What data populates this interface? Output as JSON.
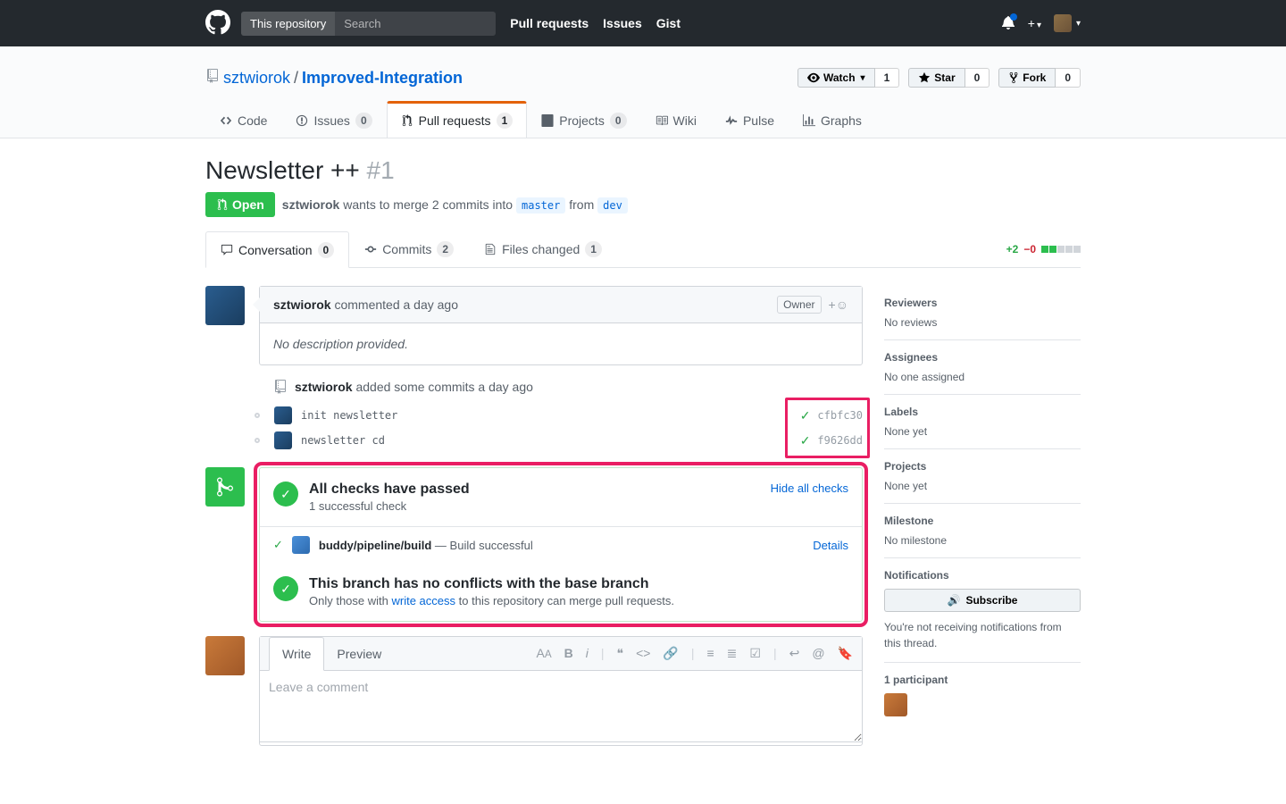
{
  "header": {
    "search_scope": "This repository",
    "search_placeholder": "Search",
    "nav": {
      "pulls": "Pull requests",
      "issues": "Issues",
      "gist": "Gist"
    }
  },
  "repo": {
    "owner": "sztwiorok",
    "name": "Improved-Integration",
    "actions": {
      "watch": {
        "label": "Watch",
        "count": "1"
      },
      "star": {
        "label": "Star",
        "count": "0"
      },
      "fork": {
        "label": "Fork",
        "count": "0"
      }
    },
    "nav": {
      "code": "Code",
      "issues": {
        "label": "Issues",
        "count": "0"
      },
      "pulls": {
        "label": "Pull requests",
        "count": "1"
      },
      "projects": {
        "label": "Projects",
        "count": "0"
      },
      "wiki": "Wiki",
      "pulse": "Pulse",
      "graphs": "Graphs"
    }
  },
  "pr": {
    "title": "Newsletter ++",
    "number": "#1",
    "state": "Open",
    "meta": {
      "author": "sztwiorok",
      "action": "wants to merge 2 commits into",
      "base": "master",
      "from_word": "from",
      "head": "dev"
    },
    "tabs": {
      "conversation": {
        "label": "Conversation",
        "count": "0"
      },
      "commits": {
        "label": "Commits",
        "count": "2"
      },
      "files": {
        "label": "Files changed",
        "count": "1"
      }
    },
    "diff": {
      "additions": "+2",
      "deletions": "−0"
    }
  },
  "comment": {
    "author": "sztwiorok",
    "timestamp": "commented a day ago",
    "owner_badge": "Owner",
    "body": "No description provided."
  },
  "commits_group": {
    "author": "sztwiorok",
    "action": "added some commits a day ago",
    "items": [
      {
        "msg": "init newsletter",
        "sha": "cfbfc30"
      },
      {
        "msg": "newsletter cd",
        "sha": "f9626dd"
      }
    ]
  },
  "merge": {
    "checks_title": "All checks have passed",
    "checks_sub": "1 successful check",
    "hide": "Hide all checks",
    "check": {
      "name": "buddy/pipeline/build",
      "dash": "—",
      "status": "Build successful",
      "details": "Details"
    },
    "conflict_title": "This branch has no conflicts with the base branch",
    "conflict_sub_pre": "Only those with ",
    "conflict_link": "write access",
    "conflict_sub_post": " to this repository can merge pull requests."
  },
  "form": {
    "write": "Write",
    "preview": "Preview",
    "placeholder": "Leave a comment"
  },
  "sidebar": {
    "reviewers": {
      "title": "Reviewers",
      "val": "No reviews"
    },
    "assignees": {
      "title": "Assignees",
      "val": "No one assigned"
    },
    "labels": {
      "title": "Labels",
      "val": "None yet"
    },
    "projects": {
      "title": "Projects",
      "val": "None yet"
    },
    "milestone": {
      "title": "Milestone",
      "val": "No milestone"
    },
    "notifications": {
      "title": "Notifications",
      "subscribe": "Subscribe",
      "text": "You're not receiving notifications from this thread."
    },
    "participants": {
      "title": "1 participant"
    }
  }
}
